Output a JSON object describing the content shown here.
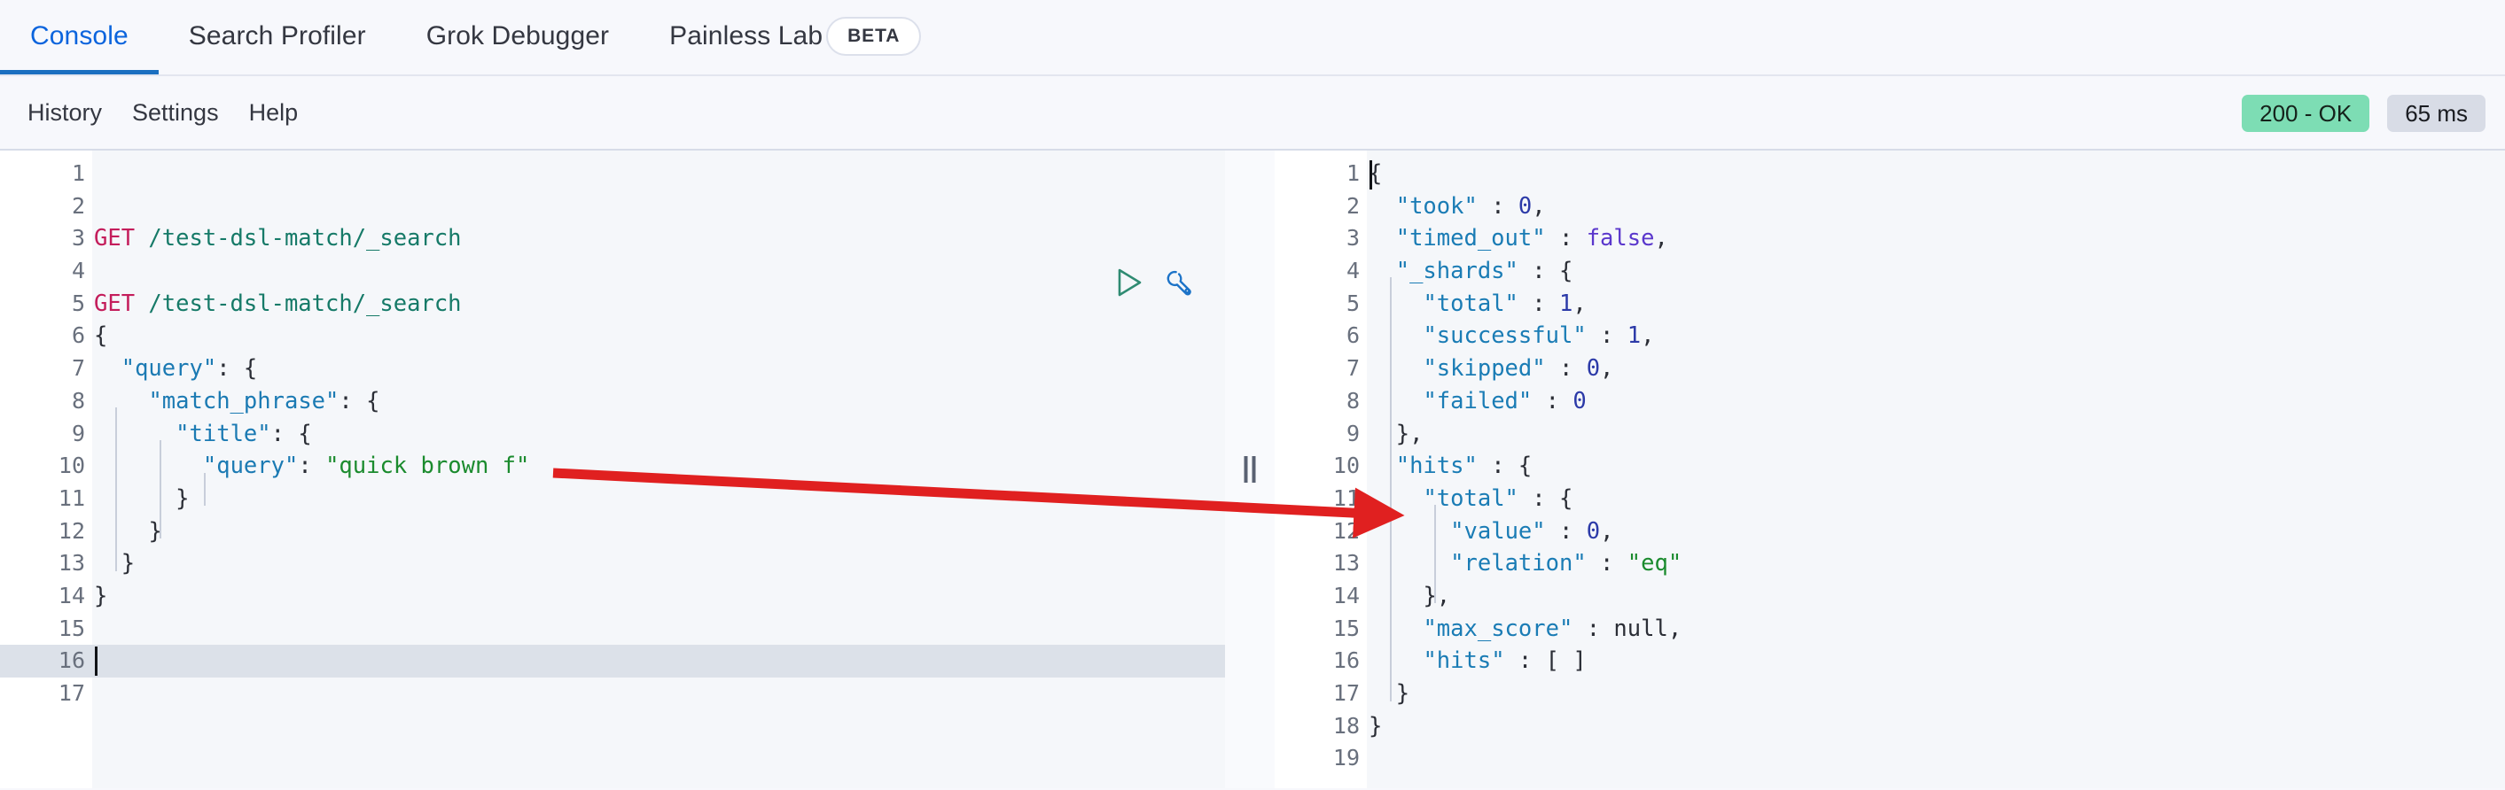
{
  "app": {
    "accent_blue": "#0B64DD",
    "active_tab_underline": "#1B6FC0",
    "status_badge_bg": "#7DDDB4",
    "time_badge_bg": "#D8DCE6",
    "annotation_arrow_color": "#E02020"
  },
  "tabs": [
    {
      "label": "Console",
      "active": true
    },
    {
      "label": "Search Profiler",
      "active": false
    },
    {
      "label": "Grok Debugger",
      "active": false
    },
    {
      "label": "Painless Lab",
      "active": false
    }
  ],
  "beta_badge": "BETA",
  "toolbar": {
    "links": [
      "History",
      "Settings",
      "Help"
    ],
    "status_label": "200 - OK",
    "time_label": "65 ms"
  },
  "icons": {
    "run": "play-icon",
    "wrench": "wrench-icon",
    "splitter": "resize-handle-icon"
  },
  "request_editor": {
    "active_line": 16,
    "total_lines": 17,
    "lines": [
      {
        "n": 1,
        "fold": "",
        "text": ""
      },
      {
        "n": 2,
        "fold": "",
        "text": ""
      },
      {
        "n": 3,
        "fold": "",
        "text": "GET /test-dsl-match/_search"
      },
      {
        "n": 4,
        "fold": "",
        "text": ""
      },
      {
        "n": 5,
        "fold": "",
        "text": "GET /test-dsl-match/_search"
      },
      {
        "n": 6,
        "fold": "▾",
        "text": "{"
      },
      {
        "n": 7,
        "fold": "▾",
        "text": "  \"query\": {"
      },
      {
        "n": 8,
        "fold": "▾",
        "text": "    \"match_phrase\": {"
      },
      {
        "n": 9,
        "fold": "▾",
        "text": "      \"title\": {"
      },
      {
        "n": 10,
        "fold": "",
        "text": "        \"query\": \"quick brown f\""
      },
      {
        "n": 11,
        "fold": "▴",
        "text": "      }"
      },
      {
        "n": 12,
        "fold": "▴",
        "text": "    }"
      },
      {
        "n": 13,
        "fold": "▴",
        "text": "  }"
      },
      {
        "n": 14,
        "fold": "▴",
        "text": "}"
      },
      {
        "n": 15,
        "fold": "",
        "text": ""
      },
      {
        "n": 16,
        "fold": "",
        "text": ""
      },
      {
        "n": 17,
        "fold": "",
        "text": ""
      }
    ],
    "method": "GET",
    "path": "/test-dsl-match/_search",
    "query_string_value": "quick brown f"
  },
  "response_viewer": {
    "active_line": 1,
    "total_lines": 19,
    "lines": [
      {
        "n": 1,
        "fold": "▾",
        "text": "{"
      },
      {
        "n": 2,
        "fold": "",
        "text": "  \"took\" : 0,"
      },
      {
        "n": 3,
        "fold": "",
        "text": "  \"timed_out\" : false,"
      },
      {
        "n": 4,
        "fold": "▾",
        "text": "  \"_shards\" : {"
      },
      {
        "n": 5,
        "fold": "",
        "text": "    \"total\" : 1,"
      },
      {
        "n": 6,
        "fold": "",
        "text": "    \"successful\" : 1,"
      },
      {
        "n": 7,
        "fold": "",
        "text": "    \"skipped\" : 0,"
      },
      {
        "n": 8,
        "fold": "",
        "text": "    \"failed\" : 0"
      },
      {
        "n": 9,
        "fold": "▴",
        "text": "  },"
      },
      {
        "n": 10,
        "fold": "▾",
        "text": "  \"hits\" : {"
      },
      {
        "n": 11,
        "fold": "▾",
        "text": "    \"total\" : {"
      },
      {
        "n": 12,
        "fold": "",
        "text": "      \"value\" : 0,"
      },
      {
        "n": 13,
        "fold": "",
        "text": "      \"relation\" : \"eq\""
      },
      {
        "n": 14,
        "fold": "▴",
        "text": "    },"
      },
      {
        "n": 15,
        "fold": "",
        "text": "    \"max_score\" : null,"
      },
      {
        "n": 16,
        "fold": "",
        "text": "    \"hits\" : [ ]"
      },
      {
        "n": 17,
        "fold": "▴",
        "text": "  }"
      },
      {
        "n": 18,
        "fold": "▴",
        "text": "}"
      },
      {
        "n": 19,
        "fold": "",
        "text": ""
      }
    ],
    "values": {
      "took": 0,
      "timed_out": "false",
      "shards_total": 1,
      "shards_successful": 1,
      "shards_skipped": 0,
      "shards_failed": 0,
      "hits_total_value": 0,
      "hits_total_relation": "eq",
      "max_score": "null",
      "hits": "[ ]"
    }
  }
}
